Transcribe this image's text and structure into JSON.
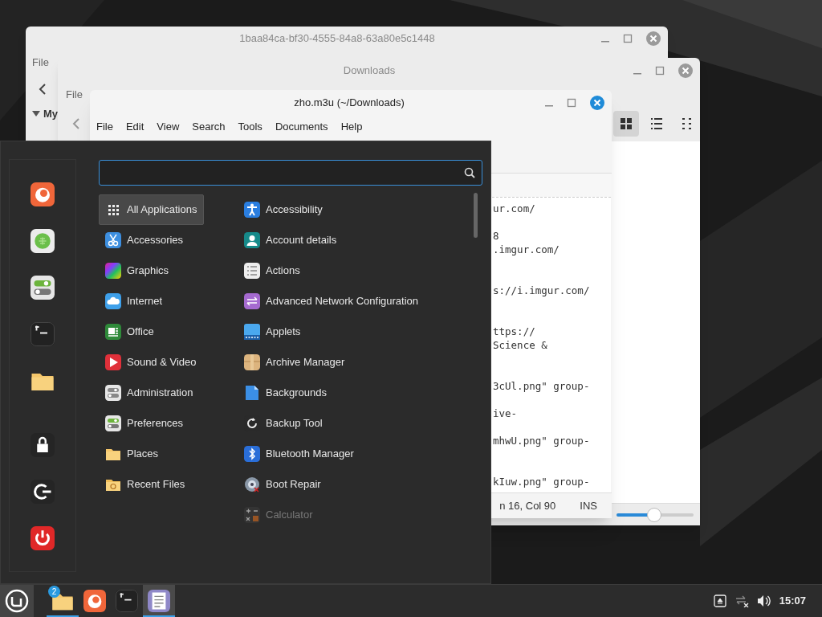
{
  "windows": [
    {
      "title": "1baa84ca-bf30-4555-84a8-63a80e5c1448",
      "menu": [
        "File"
      ],
      "sidebar_heading": "My"
    },
    {
      "title": "Downloads",
      "menu": [
        "File"
      ],
      "view_modes": [
        {
          "kind": "grid",
          "selected": true
        },
        {
          "kind": "list",
          "selected": false
        },
        {
          "kind": "compact",
          "selected": false
        }
      ],
      "zoom": {
        "level": 0.49
      }
    },
    {
      "title": "zho.m3u (~/Downloads)",
      "menu": [
        "File",
        "Edit",
        "View",
        "Search",
        "Tools",
        "Documents",
        "Help"
      ],
      "lines": [
        "ur.com/",
        "8",
        ".imgur.com/",
        "s://i.imgur.com/",
        "ttps://",
        "Science &",
        "3cUl.png\" group-",
        "ive-",
        "mhwU.png\" group-",
        "kIuw.png\" group-"
      ],
      "status": {
        "position": "n 16, Col 90",
        "mode": "INS"
      }
    }
  ],
  "menu": {
    "search": {
      "focused": true
    },
    "favorites": [
      {
        "kind": "firefox"
      },
      {
        "kind": "grid-app"
      },
      {
        "kind": "toggles"
      },
      {
        "kind": "terminal"
      },
      {
        "kind": "folder"
      }
    ],
    "session": [
      {
        "kind": "lock"
      },
      {
        "kind": "logout"
      },
      {
        "kind": "power"
      }
    ],
    "categories": [
      {
        "label": "All Applications",
        "kind": "dots",
        "selected": true
      },
      {
        "label": "Accessories",
        "kind": "scissors",
        "selected": false
      },
      {
        "label": "Graphics",
        "kind": "rainbow",
        "selected": false
      },
      {
        "label": "Internet",
        "kind": "cloud",
        "selected": false
      },
      {
        "label": "Office",
        "kind": "office",
        "selected": false
      },
      {
        "label": "Sound & Video",
        "kind": "play",
        "selected": false
      },
      {
        "label": "Administration",
        "kind": "admin",
        "selected": false
      },
      {
        "label": "Preferences",
        "kind": "prefs",
        "selected": false
      },
      {
        "label": "Places",
        "kind": "folder",
        "selected": false
      },
      {
        "label": "Recent Files",
        "kind": "recent",
        "selected": false
      }
    ],
    "apps": [
      {
        "label": "Accessibility",
        "kind": "person",
        "faded": false
      },
      {
        "label": "Account details",
        "kind": "account",
        "faded": false
      },
      {
        "label": "Actions",
        "kind": "list",
        "faded": false
      },
      {
        "label": "Advanced Network Configuration",
        "kind": "network",
        "faded": false
      },
      {
        "label": "Applets",
        "kind": "applets",
        "faded": false
      },
      {
        "label": "Archive Manager",
        "kind": "box",
        "faded": false
      },
      {
        "label": "Backgrounds",
        "kind": "page",
        "faded": false
      },
      {
        "label": "Backup Tool",
        "kind": "backup",
        "faded": false
      },
      {
        "label": "Bluetooth Manager",
        "kind": "bluetooth",
        "faded": false
      },
      {
        "label": "Boot Repair",
        "kind": "disc",
        "faded": false
      },
      {
        "label": "Calculator",
        "kind": "calc",
        "faded": true
      }
    ]
  },
  "taskbar": {
    "apps": [
      {
        "kind": "folder",
        "badge": "2",
        "running": true,
        "active": false
      },
      {
        "kind": "firefox",
        "running": false,
        "active": false
      },
      {
        "kind": "terminal",
        "running": false,
        "active": false
      },
      {
        "kind": "editor",
        "running": true,
        "active": true
      }
    ],
    "clock": "15:07"
  }
}
